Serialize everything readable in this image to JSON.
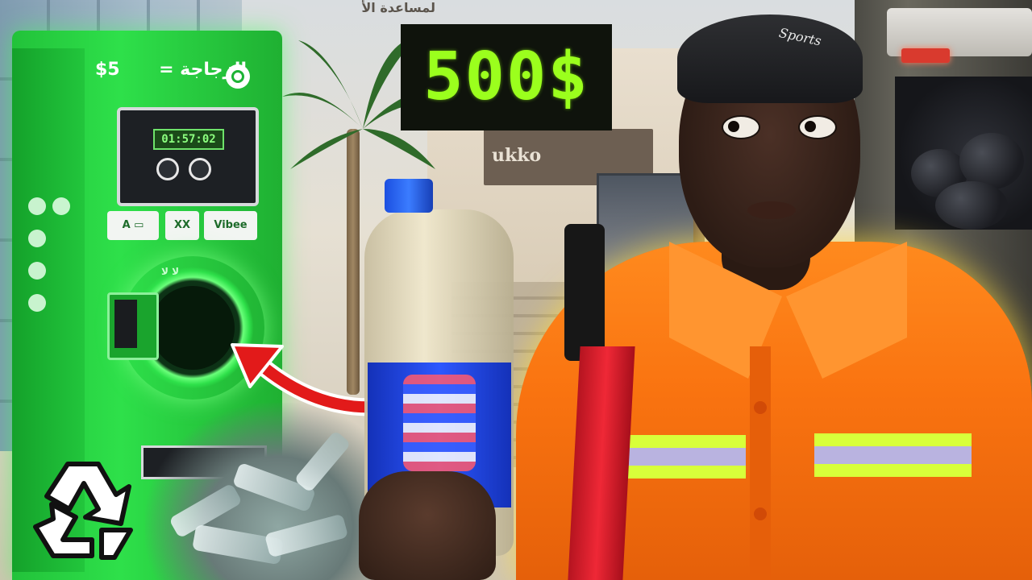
{
  "scene": {
    "background_arabic_sign": "ﻟﻤﺴﺎﻋﺪﺓ ﺍﻷ",
    "mall_sign": "ukko"
  },
  "machine": {
    "price": "$5",
    "arabic_label": "الزجاجة =",
    "display_text": "01:57:02",
    "slot_label": "لا لا",
    "tags": [
      "Vibee",
      "XX",
      "A  ▭"
    ]
  },
  "overlay": {
    "price_badge_text": "500$",
    "price_color": "#9bff1d"
  },
  "worker": {
    "cap_text": "Sports"
  },
  "colors": {
    "machine_green": "#2ee04a",
    "vest_orange": "#f97310",
    "reflective_stripe": "#d8ff3a",
    "arrow_red": "#e21a1a",
    "bottle_cap_blue": "#1b4fe0"
  },
  "icons": {
    "recycle": "recycle-icon",
    "arrow": "curved-arrow-icon"
  }
}
